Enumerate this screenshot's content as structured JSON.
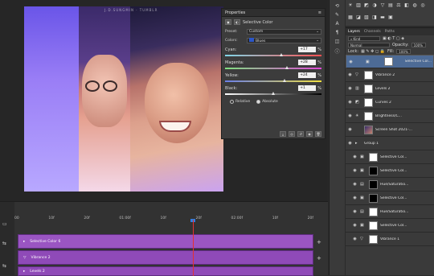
{
  "watermark": "J.D.SUNGMIN · TUMBLR",
  "properties": {
    "title": "Properties",
    "subtitle": "Selective Color",
    "preset_label": "Preset:",
    "preset_value": "Custom",
    "colors_label": "Colors:",
    "colors_value": "Blues",
    "colors_swatch": "#2c57c8",
    "sliders": [
      {
        "label": "Cyan:",
        "value": "+17",
        "unit": "%",
        "level": 0.58
      },
      {
        "label": "Magenta:",
        "value": "+28",
        "unit": "%",
        "level": 0.64
      },
      {
        "label": "Yellow:",
        "value": "+24",
        "unit": "%",
        "level": 0.62
      },
      {
        "label": "Black:",
        "value": "+1",
        "unit": "%",
        "level": 0.5
      }
    ],
    "relative_label": "Relative",
    "absolute_label": "Absolute",
    "mode_selected": "Absolute"
  },
  "layers_panel": {
    "tabs": [
      "Layers",
      "Channels",
      "Paths"
    ],
    "active_tab": "Layers",
    "filter_value": "Kind",
    "blend_mode": "Normal",
    "opacity_label": "Opacity:",
    "opacity_value": "100%",
    "lock_label": "Lock:",
    "fill_label": "Fill:",
    "fill_value": "100%",
    "layers": [
      {
        "name": "Selective Col...",
        "thumb": "white",
        "adj": "▣",
        "selected": true,
        "indent": false
      },
      {
        "name": "Vibrance 2",
        "thumb": "white",
        "adj": "▽",
        "selected": false,
        "indent": false
      },
      {
        "name": "Levels 2",
        "thumb": "white",
        "adj": "▥",
        "selected": false,
        "indent": false
      },
      {
        "name": "Curves 2",
        "thumb": "white",
        "adj": "◩",
        "selected": false,
        "indent": false
      },
      {
        "name": "Brightness/C...",
        "thumb": "white",
        "adj": "☀",
        "selected": false,
        "indent": false
      },
      {
        "name": "Screen Shot 2021-...",
        "thumb": "photo",
        "adj": "",
        "selected": false,
        "indent": false
      },
      {
        "name": "Group 1",
        "thumb": "",
        "adj": "▸",
        "selected": false,
        "indent": false
      },
      {
        "name": "Selective Col...",
        "thumb": "white",
        "adj": "▣",
        "selected": false,
        "indent": true
      },
      {
        "name": "Selective Col...",
        "thumb": "dark",
        "adj": "▣",
        "selected": false,
        "indent": true
      },
      {
        "name": "Hue/Saturatio...",
        "thumb": "dark",
        "adj": "▤",
        "selected": false,
        "indent": true
      },
      {
        "name": "Selective Col...",
        "thumb": "dark",
        "adj": "▣",
        "selected": false,
        "indent": true
      },
      {
        "name": "Hue/Saturatio...",
        "thumb": "white",
        "adj": "▤",
        "selected": false,
        "indent": true
      },
      {
        "name": "Selective Col...",
        "thumb": "white",
        "adj": "▣",
        "selected": false,
        "indent": true
      },
      {
        "name": "Vibrance 1",
        "thumb": "white",
        "adj": "▽",
        "selected": false,
        "indent": true
      }
    ]
  },
  "timeline": {
    "ticks": [
      "00",
      "10f",
      "20f",
      "01:00f",
      "10f",
      "20f",
      "02:00f",
      "10f",
      "20f"
    ],
    "current_time": "02:00f",
    "tracks": [
      "Selective Color 6",
      "Vibrance 2",
      "Levels 2"
    ]
  }
}
